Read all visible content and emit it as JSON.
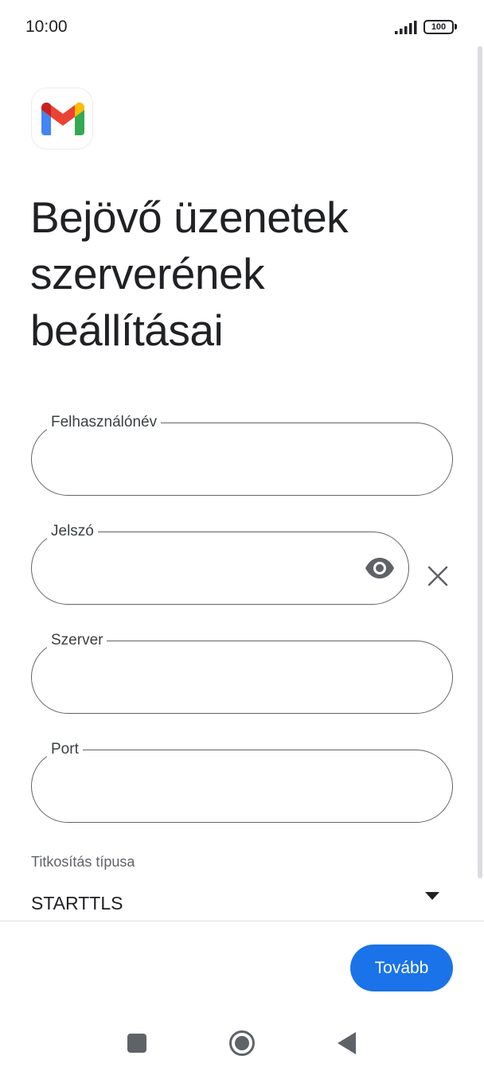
{
  "status_bar": {
    "time": "10:00",
    "battery": "100",
    "icons": [
      "signal-icon",
      "battery-icon"
    ]
  },
  "app": {
    "logo_icon": "gmail-logo-icon"
  },
  "page": {
    "title": "Bejövő üzenetek szerverének beállításai"
  },
  "form": {
    "username": {
      "label": "Felhasználónév",
      "value": ""
    },
    "password": {
      "label": "Jelszó",
      "value": "",
      "toggle_icon": "eye-icon",
      "clear_icon": "close-icon"
    },
    "server": {
      "label": "Szerver",
      "value": ""
    },
    "port": {
      "label": "Port",
      "value": ""
    },
    "encryption": {
      "label": "Titkosítás típusa",
      "value": "STARTTLS",
      "icon": "dropdown-arrow-icon"
    }
  },
  "actions": {
    "next_label": "Tovább"
  },
  "colors": {
    "primary": "#1a73e8",
    "outline": "#5f6368",
    "text": "#202124"
  },
  "nav_bar": {
    "icons": [
      "recents-square-icon",
      "home-circle-icon",
      "back-triangle-icon"
    ]
  }
}
